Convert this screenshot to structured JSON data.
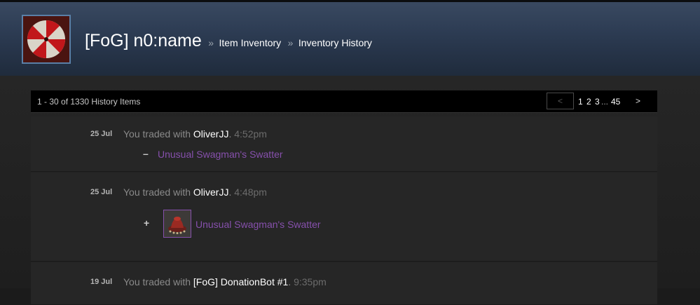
{
  "header": {
    "title": "[FoG] n0:name",
    "sep1": "»",
    "crumb1": "Item Inventory",
    "sep2": "»",
    "crumb2": "Inventory History",
    "avatar": "umbrella-logo-icon"
  },
  "pager": {
    "count_text": "1 - 30 of 1330 History Items",
    "prev": "<",
    "pages": [
      "1",
      "2",
      "3",
      "...",
      "45"
    ],
    "next": ">"
  },
  "history": [
    {
      "date": "25 Jul",
      "prefix": "You traded with ",
      "who": "OliverJJ",
      "suffix": ". ",
      "time": "4:52pm",
      "sign": "–",
      "item": "Unusual Swagman's Swatter",
      "has_thumb": false
    },
    {
      "date": "25 Jul",
      "prefix": "You traded with ",
      "who": "OliverJJ",
      "suffix": ". ",
      "time": "4:48pm",
      "sign": "+",
      "item": "Unusual Swagman's Swatter",
      "has_thumb": true
    },
    {
      "date": "19 Jul",
      "prefix": "You traded with ",
      "who": "[FoG] DonationBot #1",
      "suffix": ". ",
      "time": "9:35pm"
    }
  ],
  "colors": {
    "item_link": "#8650ac",
    "header_top": "#3a4a62",
    "header_bottom": "#1f2b3c"
  }
}
